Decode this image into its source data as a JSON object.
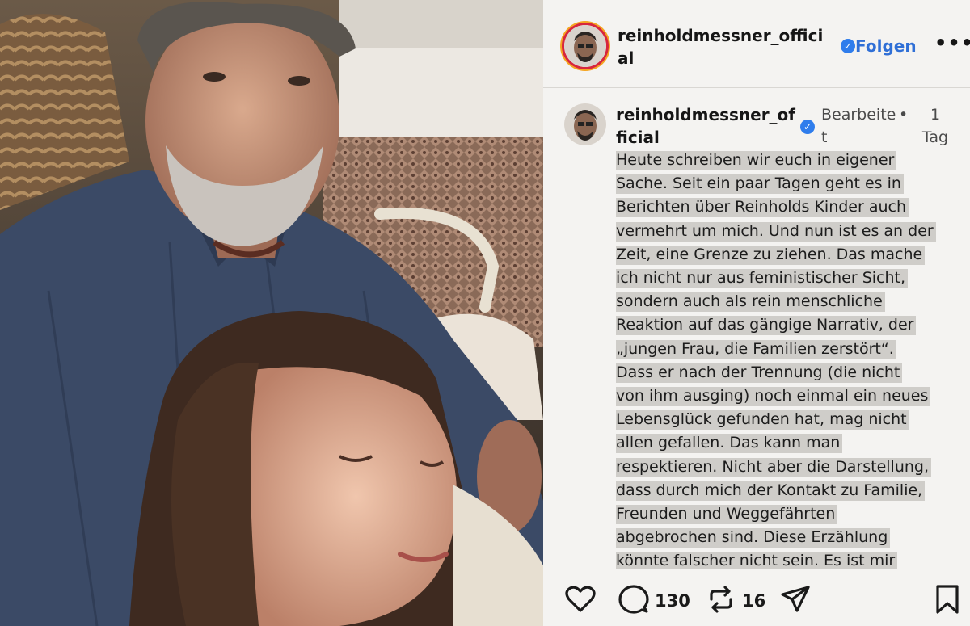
{
  "post": {
    "username": "reinholdmessner_official",
    "follow_label": "Folgen",
    "more_label": "•••"
  },
  "comment": {
    "username": "reinholdmessner_official",
    "edited_label": "Bearbeitet",
    "separator": "•",
    "time_ago": "1 Tag",
    "lines": [
      "Heute schreiben wir euch in eigener",
      "Sache. Seit ein paar Tagen geht es in",
      "Berichten über Reinholds Kinder auch",
      "vermehrt um mich. Und nun ist es an der",
      "Zeit, eine Grenze zu ziehen. Das mache",
      "ich nicht nur aus feministischer Sicht,",
      "sondern auch als rein menschliche",
      "Reaktion auf das gängige Narrativ, der",
      "„jungen Frau, die Familien zerstört“.",
      "Dass er nach der Trennung (die nicht",
      "von ihm ausging) noch einmal ein neues",
      "Lebensglück gefunden hat, mag nicht",
      "allen gefallen. Das kann man",
      "respektieren. Nicht aber die Darstellung,",
      "dass durch mich der Kontakt zu Familie,",
      "Freunden und Weggefährten",
      "abgebrochen sind. Diese Erzählung",
      "könnte falscher nicht sein. Es ist mir"
    ]
  },
  "actions": {
    "comments_count": "130",
    "reposts_count": "16"
  },
  "colors": {
    "accent": "#2f6fd6",
    "verified": "#2f7dec",
    "highlight": "#cfcdc9"
  }
}
